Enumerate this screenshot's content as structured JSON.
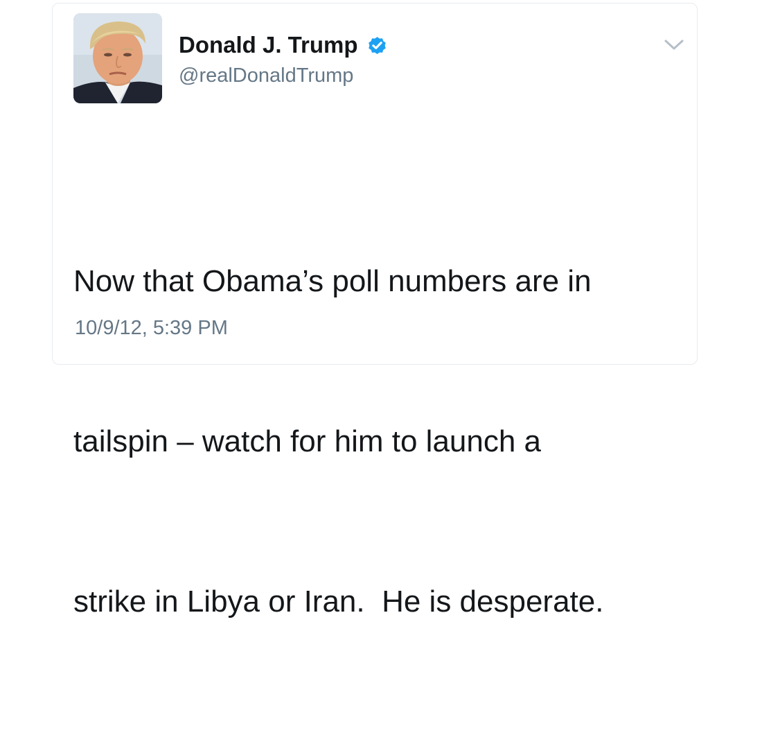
{
  "tweet": {
    "author": {
      "display_name": "Donald J. Trump",
      "handle": "@realDonaldTrump",
      "verified": true,
      "avatar_icon": "profile-photo"
    },
    "text_lines": [
      "Now that Obama’s poll numbers are in",
      "tailspin – watch for him to launch a",
      "strike in Libya or Iran.  He is desperate."
    ],
    "timestamp": "10/9/12, 5:39 PM",
    "menu_icon": "chevron-down-icon"
  },
  "colors": {
    "text_primary": "#14171a",
    "text_secondary": "#657786",
    "verified_blue": "#1da1f2",
    "border": "#e6ecf0"
  }
}
